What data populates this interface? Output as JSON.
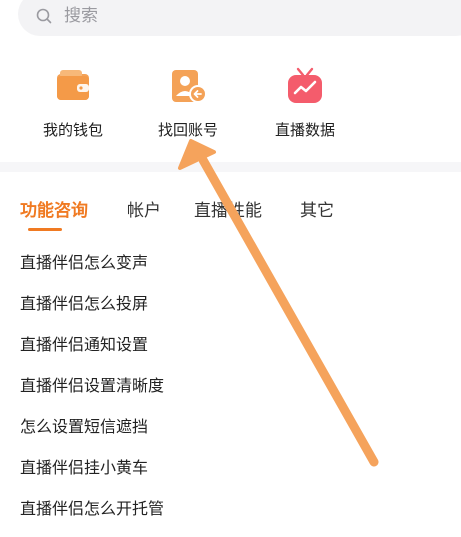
{
  "search": {
    "placeholder": "搜索"
  },
  "quick_actions": [
    {
      "label": "我的钱包",
      "icon": "wallet-icon",
      "color": "#f4a257"
    },
    {
      "label": "找回账号",
      "icon": "account-recovery-icon",
      "color": "#f4a257"
    },
    {
      "label": "直播数据",
      "icon": "tv-chart-icon",
      "color": "#f45c6c"
    }
  ],
  "tabs": [
    {
      "label": "功能咨询",
      "active": true
    },
    {
      "label": "帐户",
      "active": false
    },
    {
      "label": "直播性能",
      "active": false
    },
    {
      "label": "其它",
      "active": false
    }
  ],
  "faq": [
    "直播伴侣怎么变声",
    "直播伴侣怎么投屏",
    "直播伴侣通知设置",
    "直播伴侣设置清晰度",
    "怎么设置短信遮挡",
    "直播伴侣挂小黄车",
    "直播伴侣怎么开托管"
  ],
  "colors": {
    "accent": "#f07a22",
    "annotation_arrow": "#f5a35c"
  }
}
